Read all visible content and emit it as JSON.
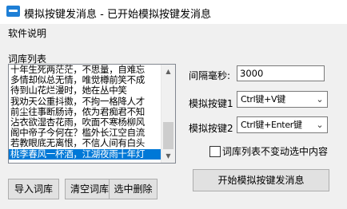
{
  "window": {
    "title": "模拟按键发消息 - 已开始模拟按键发消息",
    "app_icon": "keyboard-icon"
  },
  "menu": {
    "items": [
      "软件说明"
    ]
  },
  "word_list": {
    "label": "词库列表",
    "items": [
      "十年生死两茫茫，不思量，自难忘",
      "多情却似总无情，唯觉樽前笑不成",
      "待到山花烂漫时，她在丛中笑",
      "我劝天公重抖擞，不拘一格降人才",
      "前尘往事断肠诗，侬为君痴君不知",
      "沾衣欲湿杏花雨，吹面不寒杨柳风",
      "阁中帝子今何在？槛外长江空自流",
      "若教眼底无离恨，不信人间有白头",
      "桃李春风一杯酒，江湖夜雨十年灯"
    ],
    "selected_index": 8
  },
  "buttons": {
    "import": "导入词库",
    "clear": "清空词库",
    "delete_selected": "选中删除",
    "start": "开始模拟按键发消息"
  },
  "settings": {
    "interval_label": "间隔毫秒:",
    "interval_value": "3000",
    "key1_label": "模拟按键1",
    "key1_value": "Ctrl键+V键",
    "key2_label": "模拟按键2",
    "key2_value": "Ctrl键+Enter键",
    "keep_selection_label": "词库列表不变动选中内容",
    "keep_selection_checked": false
  },
  "colors": {
    "selection": "#0078d7",
    "window_bg": "#f0f0f0"
  }
}
